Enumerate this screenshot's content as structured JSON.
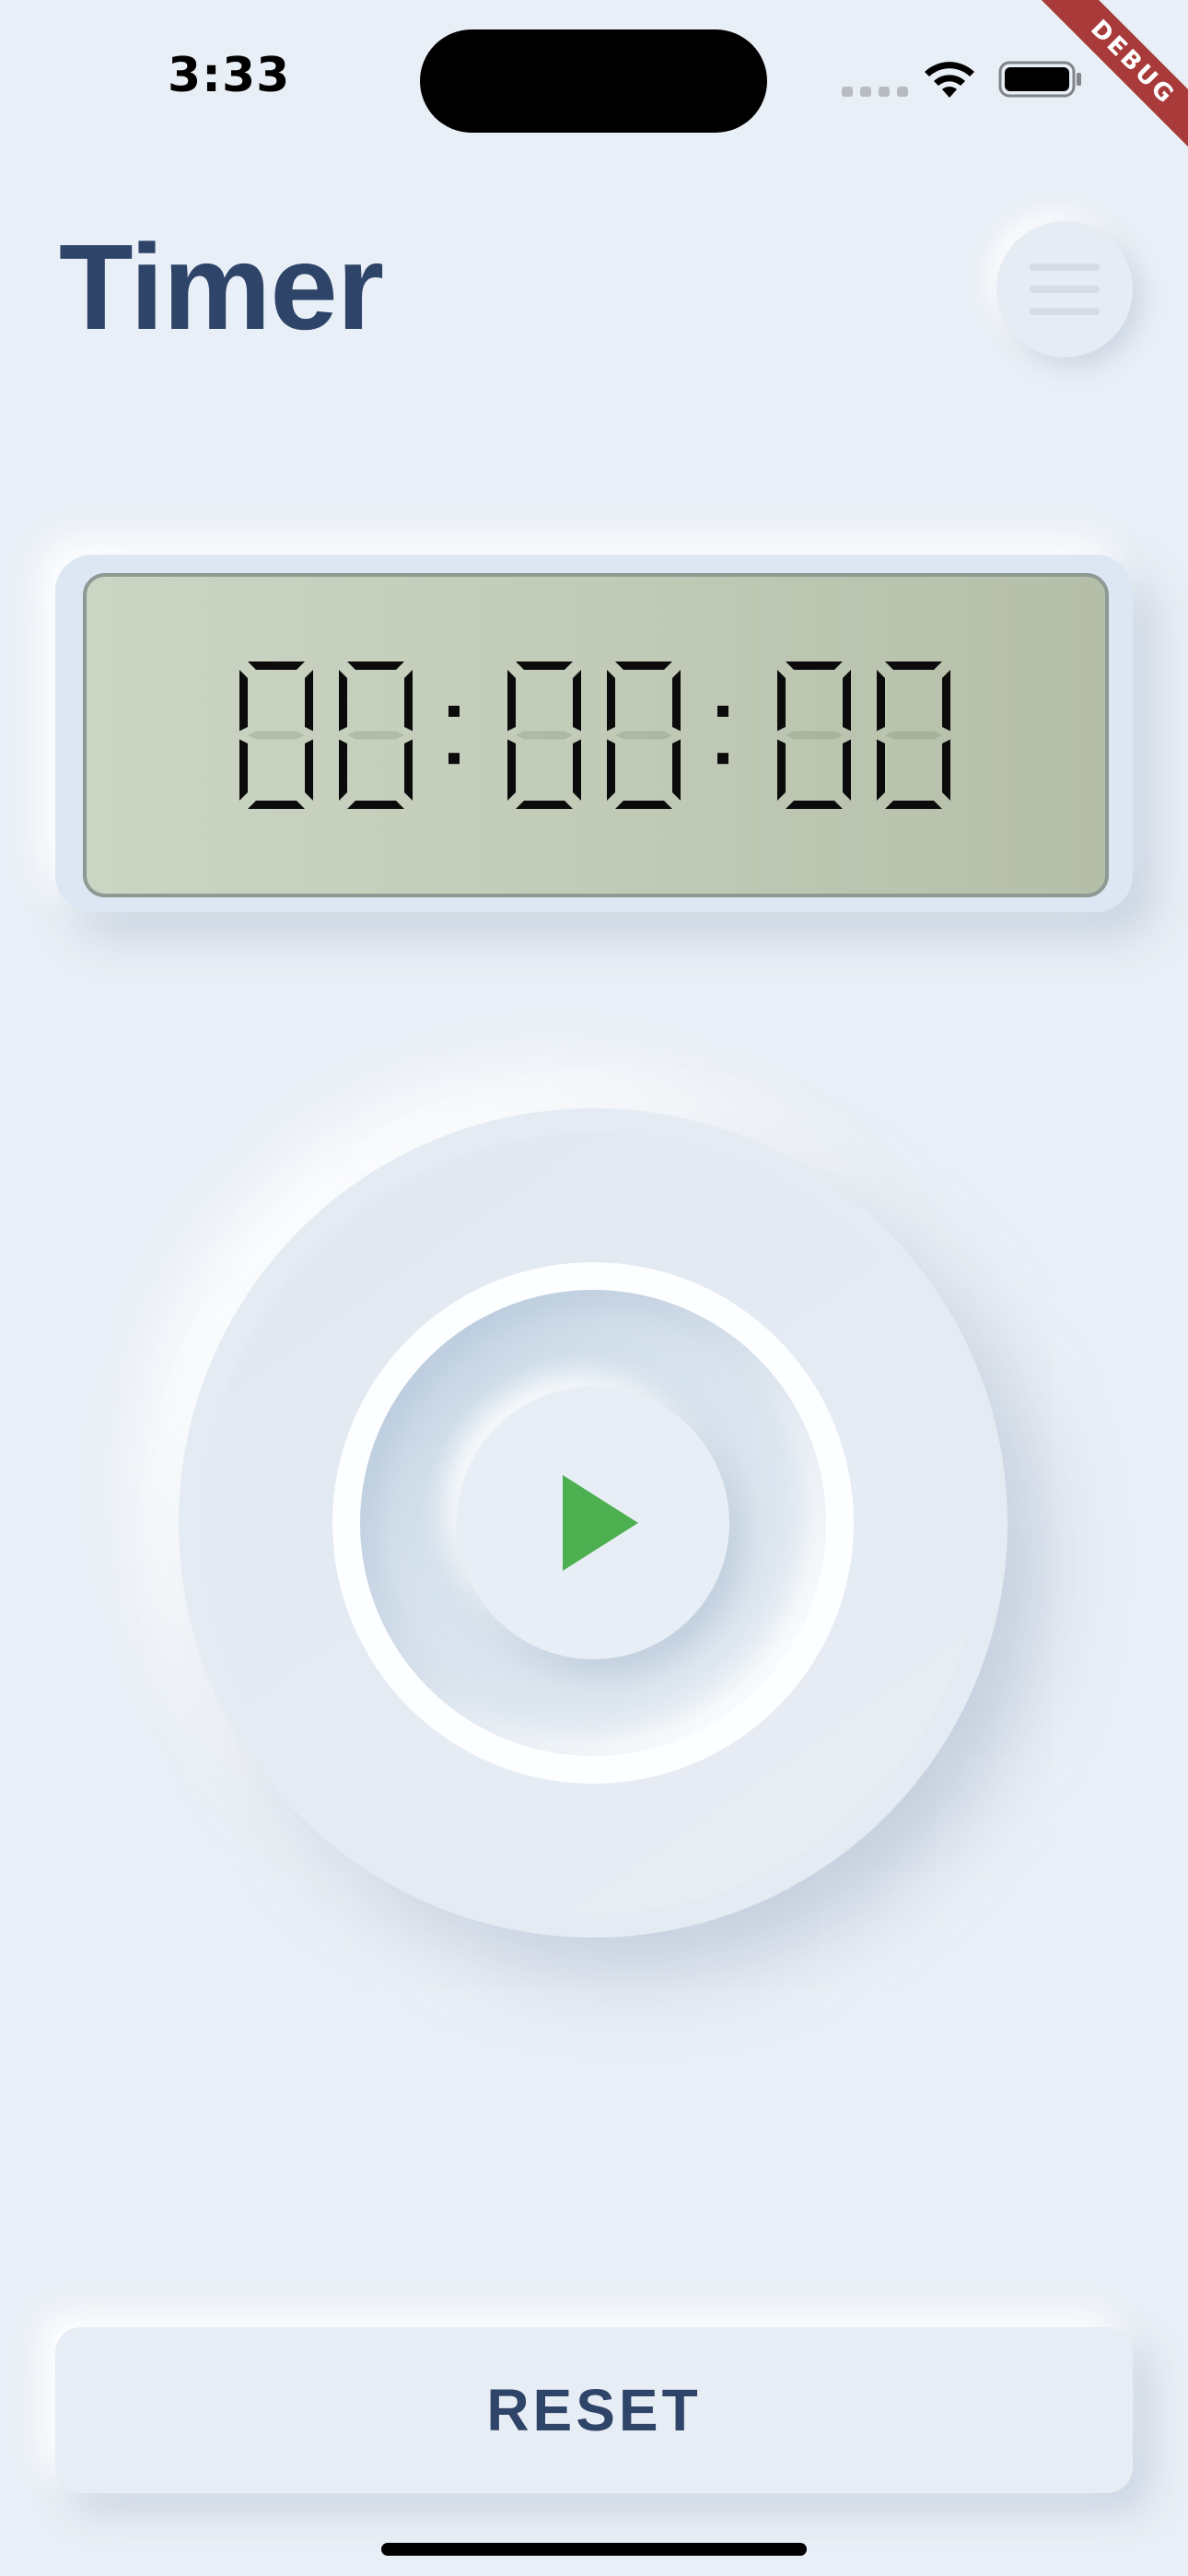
{
  "status_bar": {
    "time": "3:33",
    "signal_icon": "signal-dots-icon",
    "wifi_icon": "wifi-icon",
    "battery_icon": "battery-icon"
  },
  "debug_banner": "DEBUG",
  "header": {
    "title": "Timer",
    "menu_icon": "hamburger-menu-icon"
  },
  "display": {
    "hours": "00",
    "minutes": "00",
    "seconds": "00",
    "separator": ":"
  },
  "control": {
    "play_icon": "play-icon",
    "play_color": "#4caf50"
  },
  "reset_button": {
    "label": "RESET"
  },
  "colors": {
    "background": "#e9eff6",
    "title": "#2f4469",
    "lcd": "#c1cbb7"
  }
}
